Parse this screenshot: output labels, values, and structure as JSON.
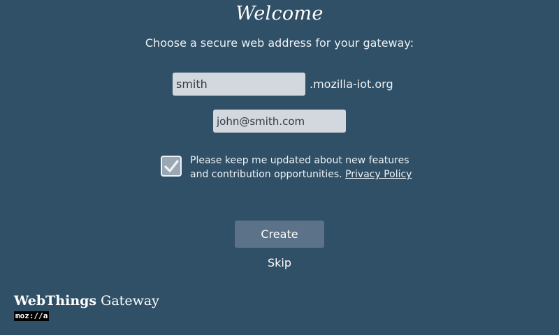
{
  "page": {
    "title": "Welcome",
    "subtitle": "Choose a secure web address for your gateway:"
  },
  "form": {
    "subdomain_value": "smith",
    "domain_suffix": ".mozilla-iot.org",
    "email_value": "john@smith.com",
    "opt_in_checked": true,
    "opt_in_text": "Please keep me updated about new features and contribution opportunities.",
    "privacy_link": "Privacy Policy",
    "create_label": "Create",
    "skip_label": "Skip"
  },
  "branding": {
    "name_bold": "WebThings",
    "name_regular": " Gateway",
    "mozilla": "moz://a"
  },
  "colors": {
    "background": "#305067",
    "input_background": "#d2d8de",
    "button_background": "#5b7288",
    "checkbox_background": "#9aa8b4"
  }
}
